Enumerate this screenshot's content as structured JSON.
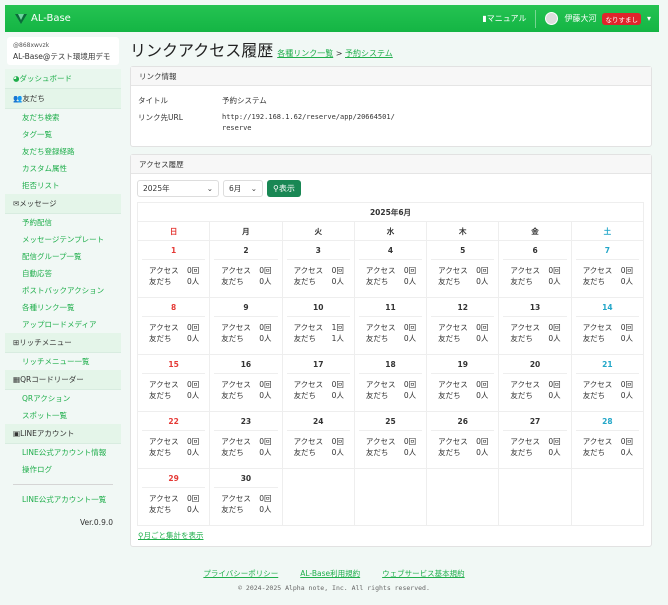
{
  "header": {
    "brand": "AL-Base",
    "manual": "マニュアル",
    "user": "伊藤大河",
    "impersonate": "なりすまし"
  },
  "sidebar": {
    "account_id": "@868xwvzk",
    "account_name": "AL-Base@テスト環境用デモ",
    "dashboard": "ダッシュボード",
    "sections": [
      {
        "label": "友だち",
        "icon": "users-icon",
        "items": [
          "友だち検索",
          "タグ一覧",
          "友だち登録経路",
          "カスタム属性",
          "拒否リスト"
        ]
      },
      {
        "label": "メッセージ",
        "icon": "envelope-icon",
        "items": [
          "予約配信",
          "メッセージテンプレート",
          "配信グループ一覧",
          "自動応答",
          "ポストバックアクション",
          "各種リンク一覧",
          "アップロードメディア"
        ]
      },
      {
        "label": "リッチメニュー",
        "icon": "grid-icon",
        "items": [
          "リッチメニュー一覧"
        ]
      },
      {
        "label": "QRコードリーダー",
        "icon": "qr-icon",
        "items": [
          "QRアクション",
          "スポット一覧"
        ]
      },
      {
        "label": "LINEアカウント",
        "icon": "line-icon",
        "items": [
          "LINE公式アカウント情報",
          "操作ログ"
        ]
      }
    ],
    "account_list": "LINE公式アカウント一覧",
    "version": "Ver.0.9.0"
  },
  "page": {
    "title": "リンクアクセス履歴",
    "crumb1": "各種リンク一覧",
    "sep": ">",
    "crumb2": "予約システム"
  },
  "link_info": {
    "header": "リンク情報",
    "title_label": "タイトル",
    "title_value": "予約システム",
    "url_label": "リンク先URL",
    "url_value": "http://192.168.1.62/reserve/app/20664501/reserve"
  },
  "history": {
    "header": "アクセス履歴",
    "year": "2025年",
    "month": "6月",
    "show": "表示",
    "calendar_title": "2025年6月",
    "weekdays": [
      "日",
      "月",
      "火",
      "水",
      "木",
      "金",
      "土"
    ],
    "access_label": "アクセス",
    "friends_label": "友だち",
    "first_weekday": 0,
    "days": [
      {
        "d": "1",
        "a": "0回",
        "f": "0人"
      },
      {
        "d": "2",
        "a": "0回",
        "f": "0人"
      },
      {
        "d": "3",
        "a": "0回",
        "f": "0人"
      },
      {
        "d": "4",
        "a": "0回",
        "f": "0人"
      },
      {
        "d": "5",
        "a": "0回",
        "f": "0人"
      },
      {
        "d": "6",
        "a": "0回",
        "f": "0人"
      },
      {
        "d": "7",
        "a": "0回",
        "f": "0人"
      },
      {
        "d": "8",
        "a": "0回",
        "f": "0人"
      },
      {
        "d": "9",
        "a": "0回",
        "f": "0人"
      },
      {
        "d": "10",
        "a": "1回",
        "f": "1人"
      },
      {
        "d": "11",
        "a": "0回",
        "f": "0人"
      },
      {
        "d": "12",
        "a": "0回",
        "f": "0人"
      },
      {
        "d": "13",
        "a": "0回",
        "f": "0人"
      },
      {
        "d": "14",
        "a": "0回",
        "f": "0人"
      },
      {
        "d": "15",
        "a": "0回",
        "f": "0人"
      },
      {
        "d": "16",
        "a": "0回",
        "f": "0人"
      },
      {
        "d": "17",
        "a": "0回",
        "f": "0人"
      },
      {
        "d": "18",
        "a": "0回",
        "f": "0人"
      },
      {
        "d": "19",
        "a": "0回",
        "f": "0人"
      },
      {
        "d": "20",
        "a": "0回",
        "f": "0人"
      },
      {
        "d": "21",
        "a": "0回",
        "f": "0人"
      },
      {
        "d": "22",
        "a": "0回",
        "f": "0人"
      },
      {
        "d": "23",
        "a": "0回",
        "f": "0人"
      },
      {
        "d": "24",
        "a": "0回",
        "f": "0人"
      },
      {
        "d": "25",
        "a": "0回",
        "f": "0人"
      },
      {
        "d": "26",
        "a": "0回",
        "f": "0人"
      },
      {
        "d": "27",
        "a": "0回",
        "f": "0人"
      },
      {
        "d": "28",
        "a": "0回",
        "f": "0人"
      },
      {
        "d": "29",
        "a": "0回",
        "f": "0人"
      },
      {
        "d": "30",
        "a": "0回",
        "f": "0人"
      }
    ],
    "monthly_link": "月ごと集計を表示"
  },
  "footer": {
    "privacy": "プライバシーポリシー",
    "terms": "AL-Base利用規約",
    "web_terms": "ウェブサービス基本規約",
    "copyright": "© 2024-2025 Alpha note, Inc. All rights reserved."
  }
}
